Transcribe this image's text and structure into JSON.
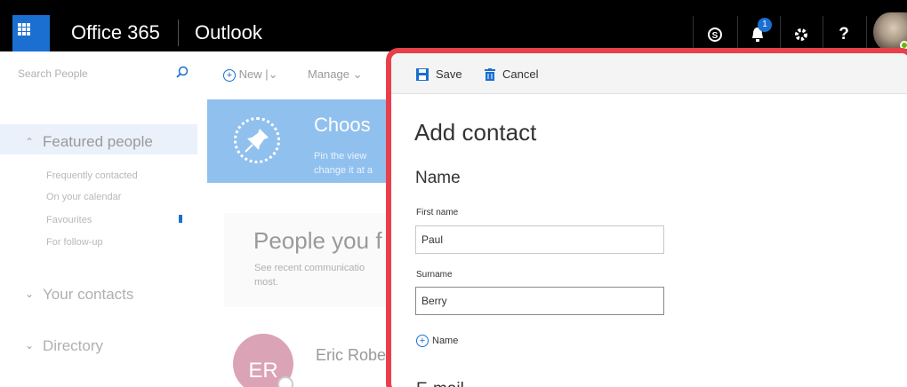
{
  "topbar": {
    "suite_name": "Office 365",
    "app_name": "Outlook",
    "notification_count": "1",
    "help_glyph": "?",
    "icons": [
      "app-launcher-icon",
      "skype-icon",
      "bell-icon",
      "gear-icon",
      "help-icon",
      "avatar"
    ]
  },
  "leftnav": {
    "search_placeholder": "Search People",
    "featured_label": "Featured people",
    "featured_items": [
      "Frequently contacted",
      "On your calendar",
      "Favourites",
      "For follow-up"
    ],
    "your_contacts": "Your contacts",
    "directory": "Directory"
  },
  "middle": {
    "new_label": "New",
    "manage_label": "Manage",
    "banner_title": "Choos",
    "banner_line1": "Pin the view",
    "banner_line2": "change it at a",
    "people_title": "People you f",
    "people_sub_line1": "See recent communicatio",
    "people_sub_line2": "most.",
    "contact_initials": "ER",
    "contact_name": "Eric Robe"
  },
  "panel": {
    "save_label": "Save",
    "cancel_label": "Cancel",
    "title": "Add contact",
    "name_section": "Name",
    "first_name_label": "First name",
    "first_name_value": "Paul",
    "surname_label": "Surname",
    "surname_value": "Berry",
    "add_name_label": "Name",
    "next_section": "E-mail"
  },
  "colors": {
    "brand_blue": "#1a6fd1",
    "highlight_red": "#e8404a",
    "banner_blue": "#90c0ee",
    "avatar_pink": "#dba3b6"
  }
}
